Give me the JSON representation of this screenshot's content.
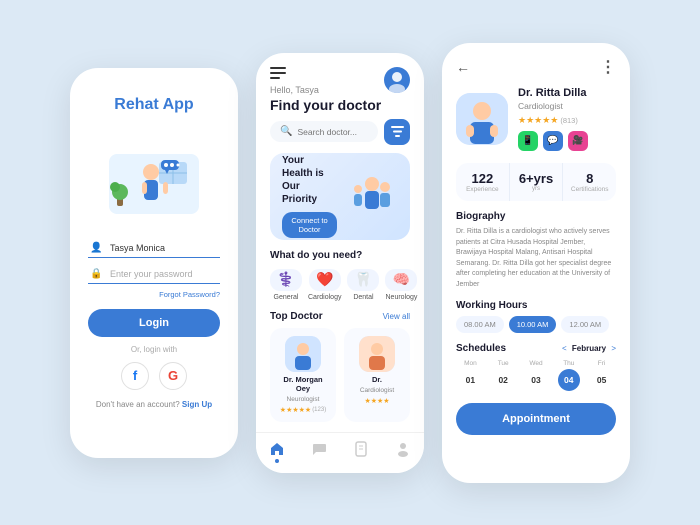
{
  "app": {
    "title": "Rehat App",
    "bg_color": "#dce9f5"
  },
  "phone1": {
    "title": "Rehat App",
    "username_placeholder": "Tasya Monica",
    "password_placeholder": "Enter your password",
    "forgot_label": "Forgot Password?",
    "login_label": "Login",
    "or_label": "Or, login with",
    "signup_text": "Don't have an account?",
    "signup_link": "Sign Up"
  },
  "phone2": {
    "hello": "Hello, Tasya",
    "title": "Find your doctor",
    "search_placeholder": "Search doctor...",
    "banner_title": "Your Health is Our Priority",
    "banner_btn": "Connect to Doctor",
    "what_label": "What do you need?",
    "categories": [
      {
        "icon": "⚕️",
        "label": "General"
      },
      {
        "icon": "❤️",
        "label": "Cardiology"
      },
      {
        "icon": "🦷",
        "label": "Dental"
      },
      {
        "icon": "🧠",
        "label": "Neurology"
      }
    ],
    "top_doctor_label": "Top Doctor",
    "view_all": "View all",
    "doctors": [
      {
        "name": "Dr. Morgan Oey",
        "spec": "Neurologist",
        "rating": "★★★★★",
        "reviews": "(123)"
      },
      {
        "name": "Dr.",
        "spec": "Cardiologist",
        "rating": "★★★★",
        "reviews": ""
      }
    ],
    "nav_items": [
      "home",
      "chat",
      "document",
      "profile"
    ]
  },
  "phone3": {
    "doctor_name": "Dr. Ritta Dilla",
    "doctor_spec": "Cardiologist",
    "rating_text": "★★★★★",
    "rating_count": "(813)",
    "stats": [
      {
        "num": "122",
        "label": "Experience"
      },
      {
        "num": "6+yrs",
        "label": ""
      },
      {
        "num": "8",
        "label": "Certifications"
      }
    ],
    "biography_title": "Biography",
    "bio_text": "Dr. Ritta Dilla is a cardiologist who actively serves patients at Citra Husada Hospital Jember, Brawijaya Hospital Malang, Antisari Hospital Semarang. Dr. Ritta Dilla got her specialist degree after completing her education at the University of Jember",
    "working_hours_title": "Working Hours",
    "times": [
      "08.00 AM",
      "10.00 AM",
      "12.00 AM"
    ],
    "active_time": "10.00 AM",
    "schedules_title": "Schedules",
    "month_nav": "< February >",
    "days": [
      {
        "name": "Mon",
        "num": "01"
      },
      {
        "name": "Tue",
        "num": "02"
      },
      {
        "name": "Wed",
        "num": "03"
      },
      {
        "name": "Thu",
        "num": "04"
      },
      {
        "name": "Fri",
        "num": "05"
      }
    ],
    "active_day": "04",
    "appointment_btn": "Appointment"
  }
}
